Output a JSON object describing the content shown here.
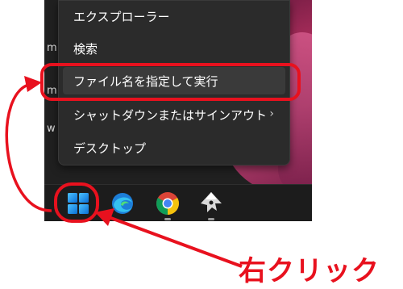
{
  "desktop": {
    "edge_chars": [
      "m",
      "m",
      "w"
    ]
  },
  "context_menu": {
    "items": [
      {
        "label": "エクスプローラー"
      },
      {
        "label": "検索"
      },
      {
        "label": "ファイル名を指定して実行"
      },
      {
        "label": "シャットダウンまたはサインアウト",
        "submenu_indicator": "›"
      },
      {
        "label": "デスクトップ"
      }
    ]
  },
  "taskbar": {
    "icons": [
      "windows-start-icon",
      "edge-icon",
      "chrome-icon",
      "inkscape-icon"
    ]
  },
  "annotation": {
    "label": "右クリック",
    "color": "#e8111e"
  }
}
